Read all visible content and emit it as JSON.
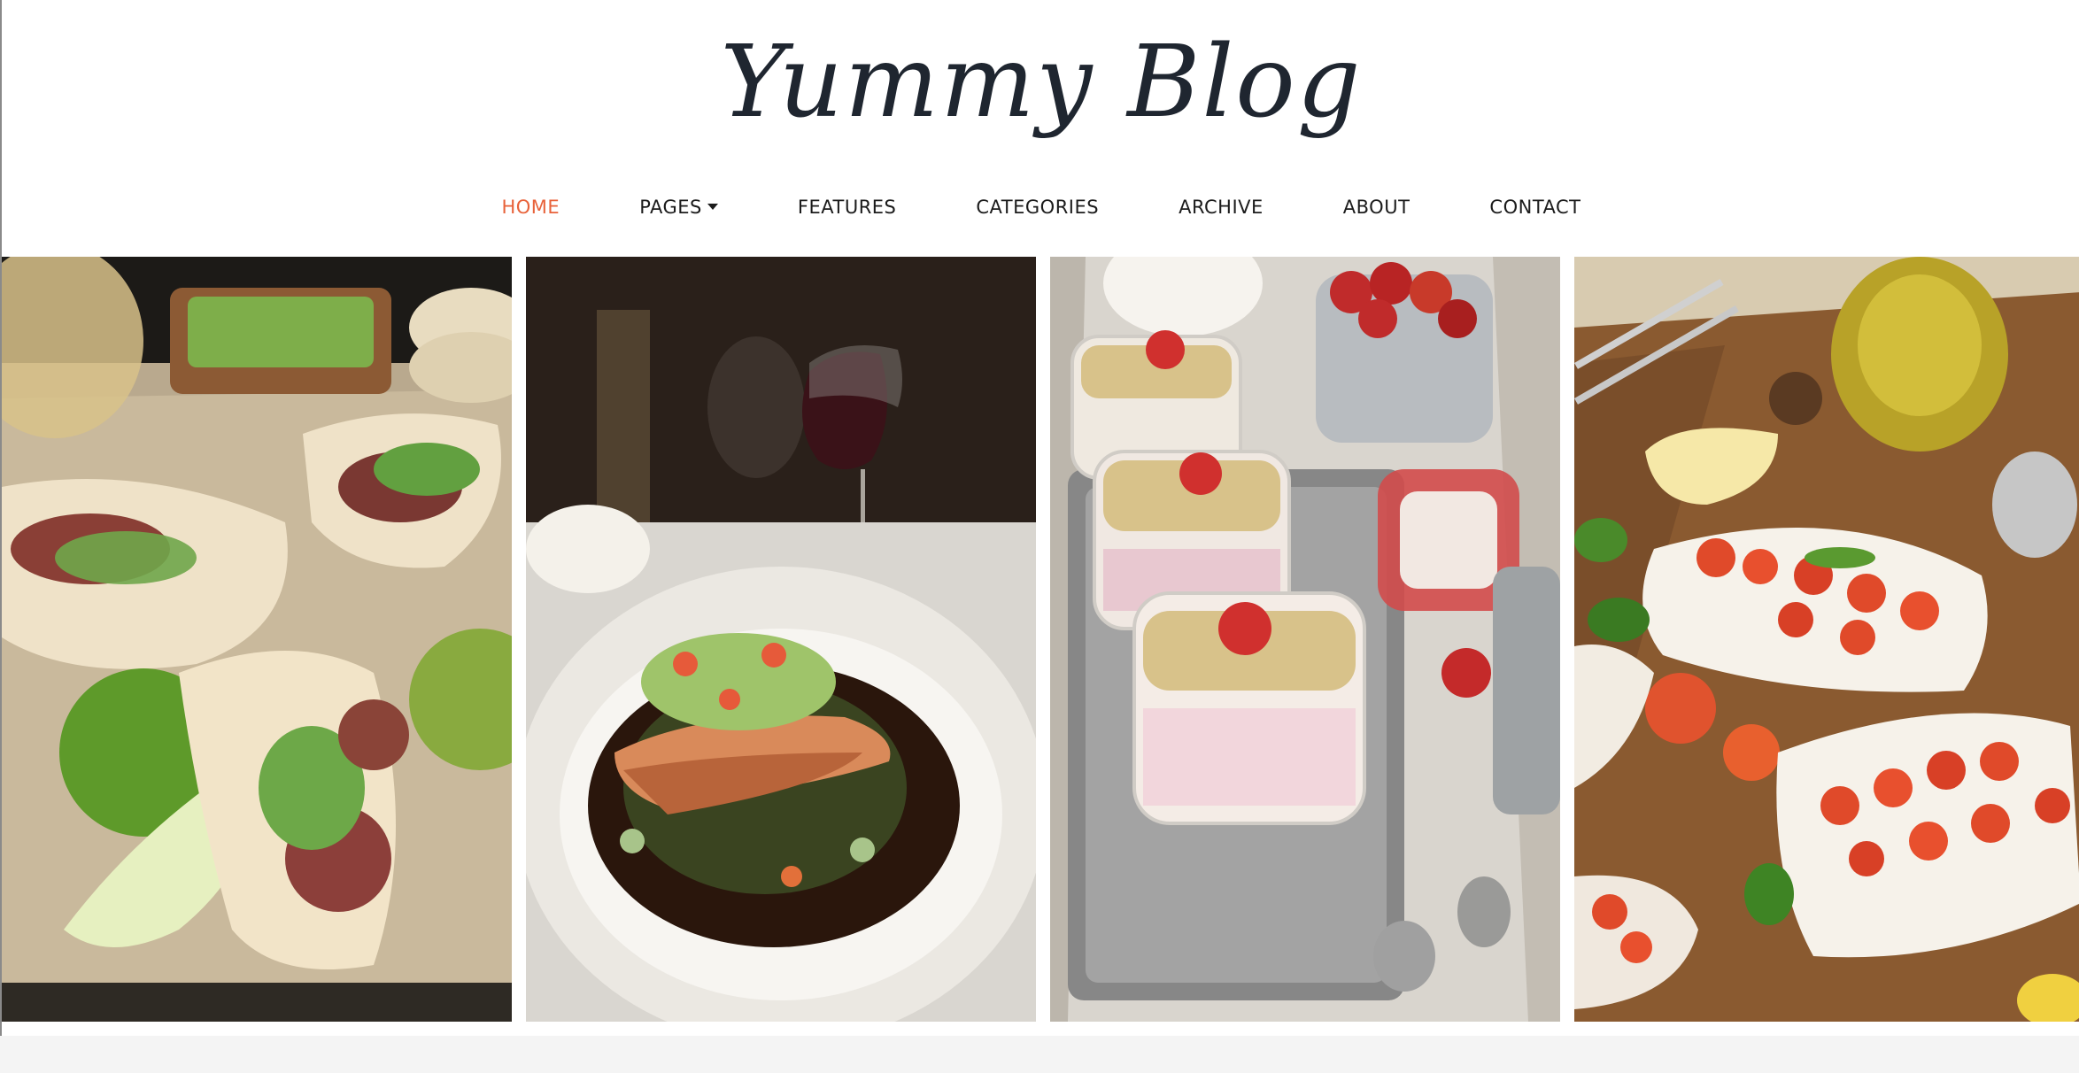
{
  "site": {
    "logo_text": "Yummy Blog"
  },
  "nav": {
    "items": [
      {
        "label": "HOME",
        "active": true
      },
      {
        "label": "PAGES",
        "dropdown": true
      },
      {
        "label": "FEATURES"
      },
      {
        "label": "CATEGORIES"
      },
      {
        "label": "ARCHIVE"
      },
      {
        "label": "ABOUT"
      },
      {
        "label": "CONTACT"
      }
    ]
  },
  "colors": {
    "accent": "#e8623a",
    "text": "#1b1b1b",
    "logo": "#1f2630"
  },
  "gallery": {
    "photos": [
      {
        "name": "tacos-photo"
      },
      {
        "name": "salmon-dish-photo"
      },
      {
        "name": "yogurt-parfait-photo"
      },
      {
        "name": "bruschetta-photo"
      }
    ]
  }
}
